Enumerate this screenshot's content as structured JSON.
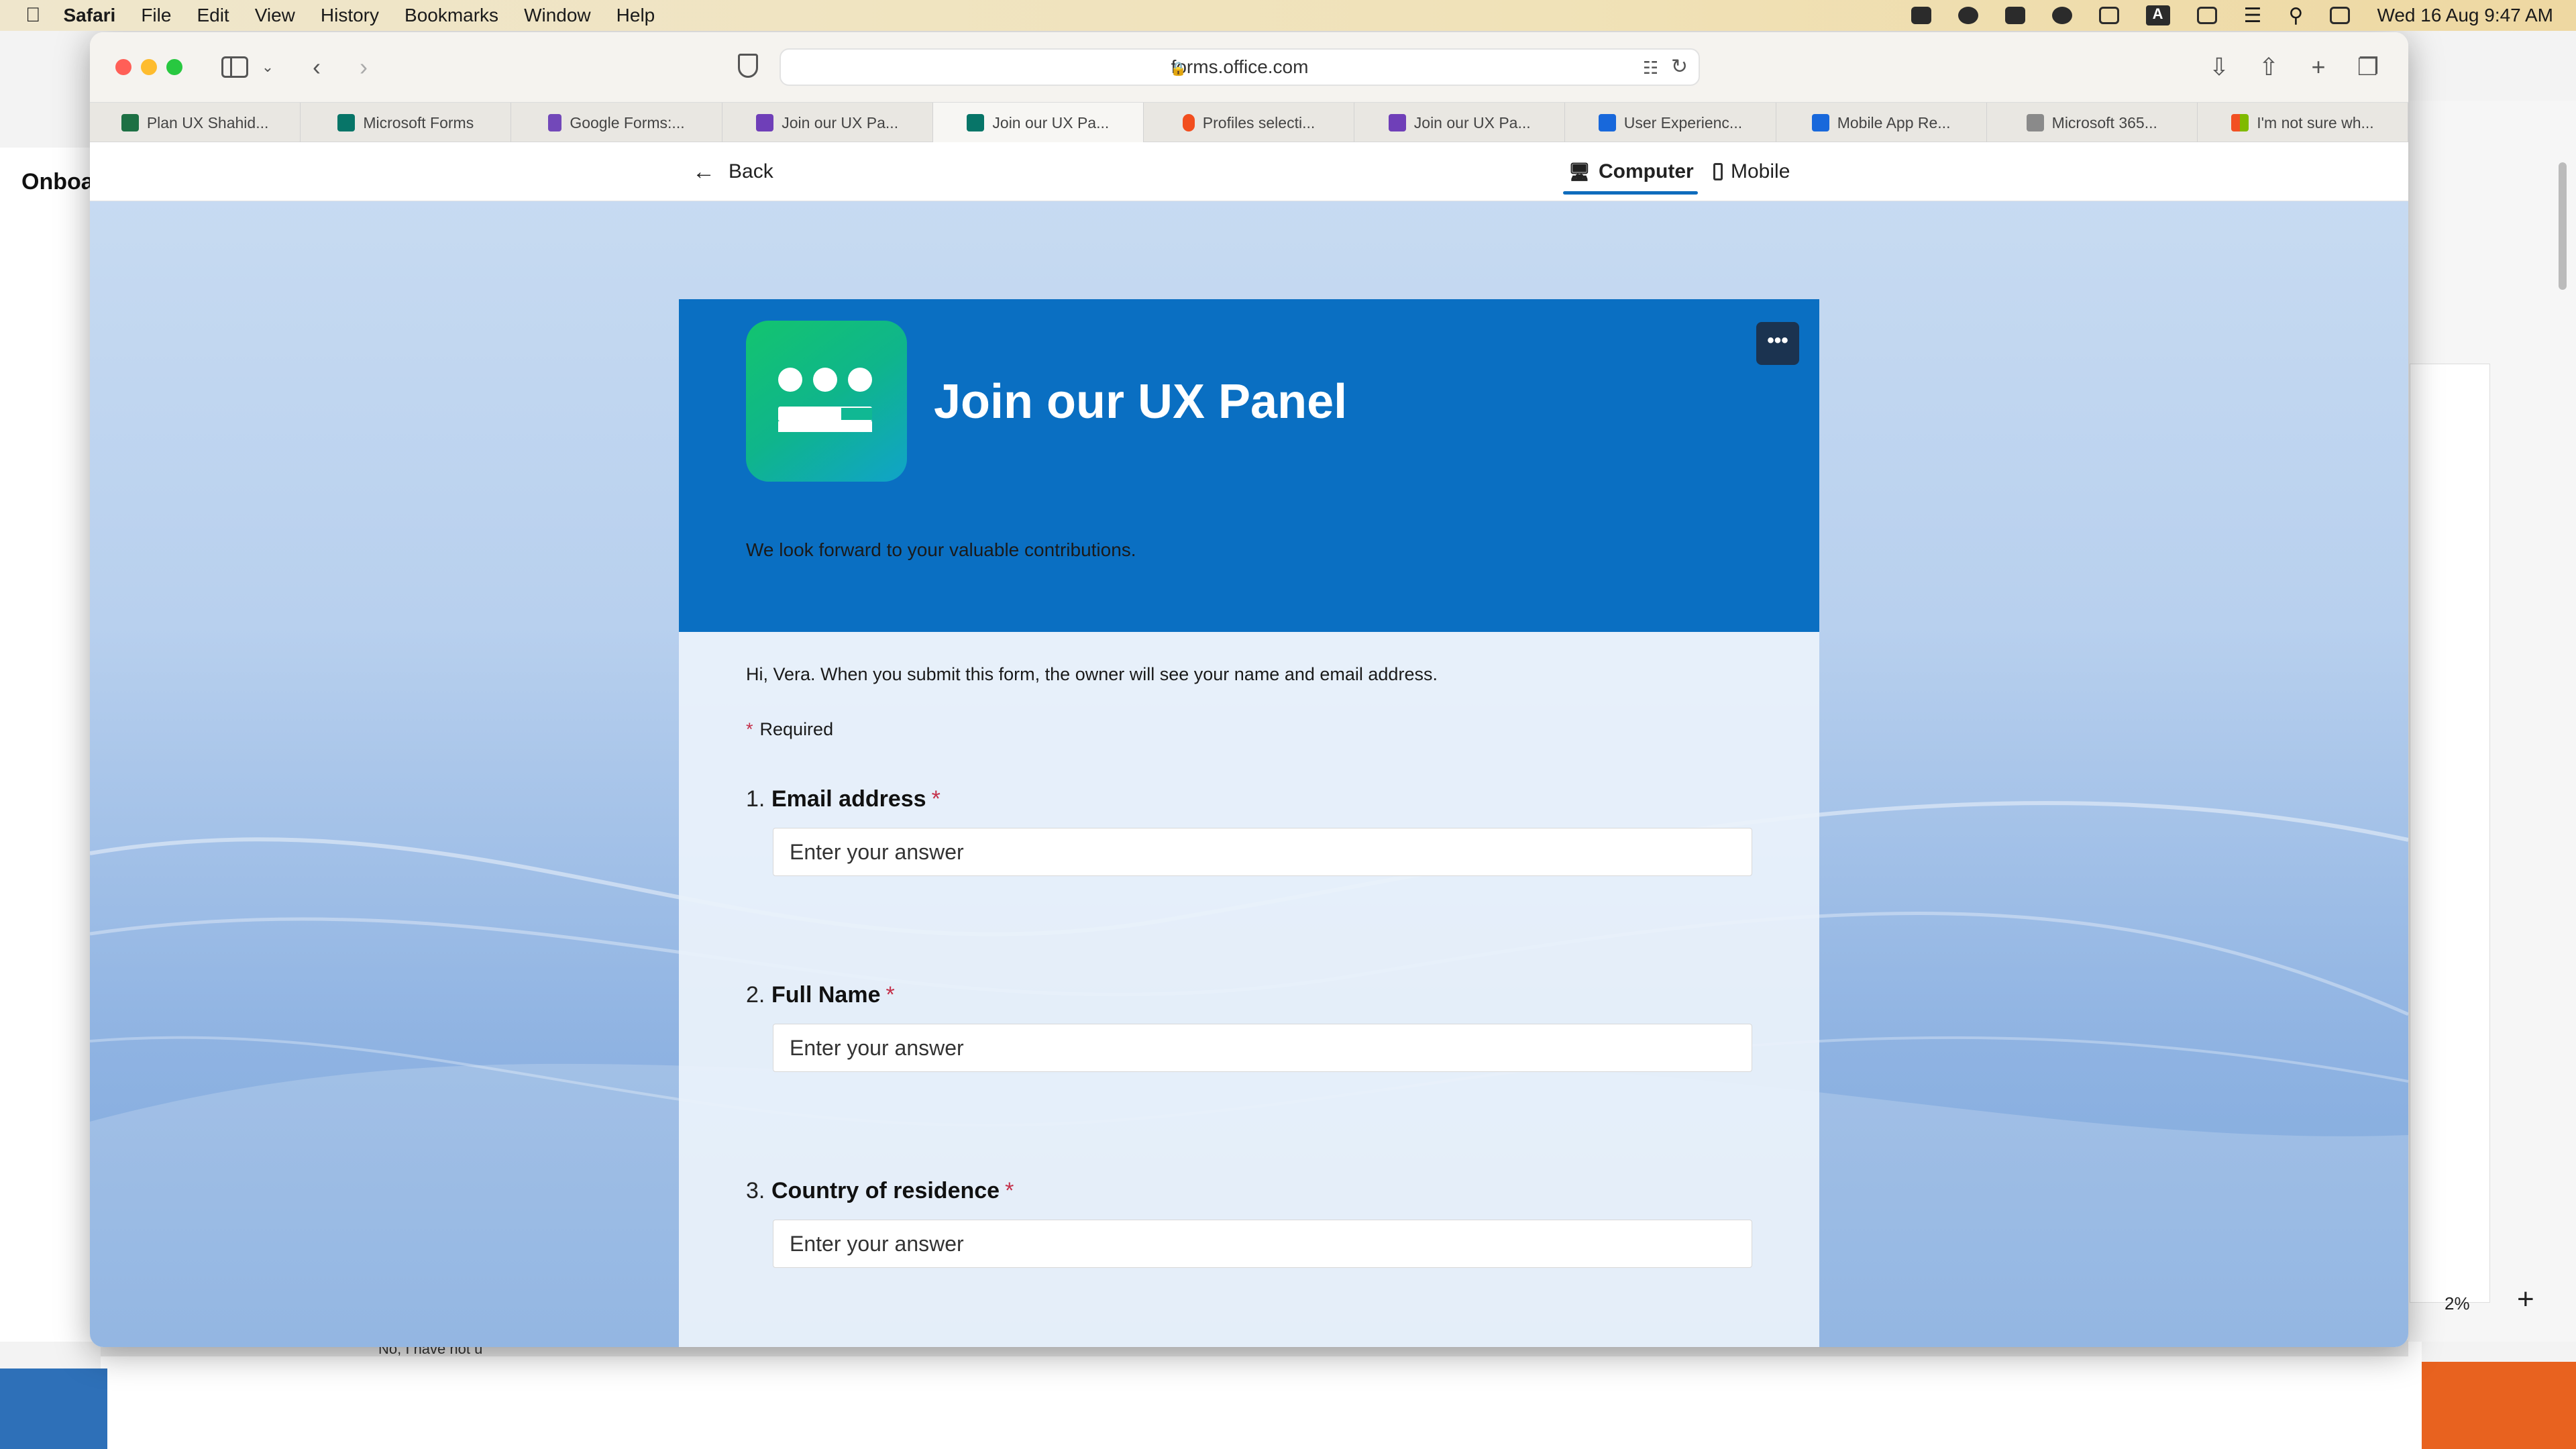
{
  "menubar": {
    "app": "Safari",
    "items": [
      "File",
      "Edit",
      "View",
      "History",
      "Bookmarks",
      "Window",
      "Help"
    ],
    "clock": "Wed 16 Aug  9:47 AM",
    "keyboard_letter": "A"
  },
  "browser": {
    "url": "forms.office.com",
    "tabs": [
      {
        "label": "Plan UX Shahid...",
        "icon_color": "#1d7044"
      },
      {
        "label": "Microsoft Forms",
        "icon_color": "#077568"
      },
      {
        "label": "Google Forms:...",
        "icon_color": "#7248b9"
      },
      {
        "label": "Join our UX Pa...",
        "icon_color": "#6f3fb8"
      },
      {
        "label": "Join our UX Pa...",
        "icon_color": "#077568"
      },
      {
        "label": "Profiles selecti...",
        "icon_color": "#f24e1e"
      },
      {
        "label": "Join our UX Pa...",
        "icon_color": "#6f3fb8"
      },
      {
        "label": "User Experienc...",
        "icon_color": "#1868db"
      },
      {
        "label": "Mobile App Re...",
        "icon_color": "#1868db"
      },
      {
        "label": "Microsoft 365...",
        "icon_color": "#8a8a8a"
      },
      {
        "label": "I'm not sure wh...",
        "icon_color": "#f25022"
      }
    ]
  },
  "background": {
    "left_window_title": "Onboa",
    "bottom_text": "No, I have not u",
    "zoom_level": "2%"
  },
  "forms_nav": {
    "back_label": "Back",
    "computer_label": "Computer",
    "mobile_label": "Mobile"
  },
  "form": {
    "title": "Join our UX Panel",
    "subtitle": "We look forward to your valuable contributions.",
    "more_label": "•••",
    "notice": "Hi, Vera. When you submit this form, the owner will see your name and email address.",
    "required_label": "Required",
    "questions": [
      {
        "number": "1.",
        "label": "Email address",
        "placeholder": "Enter your answer"
      },
      {
        "number": "2.",
        "label": "Full Name",
        "placeholder": "Enter your answer"
      },
      {
        "number": "3.",
        "label": "Country of residence",
        "placeholder": "Enter your answer"
      }
    ]
  },
  "colors": {
    "header_blue": "#0a6fc2",
    "required_red": "#c4314b",
    "accent_underline": "#0f6cbd"
  },
  "icons": {
    "back": "arrow-left-icon",
    "computer": "monitor-icon",
    "mobile": "phone-icon",
    "lock": "lock-icon"
  }
}
